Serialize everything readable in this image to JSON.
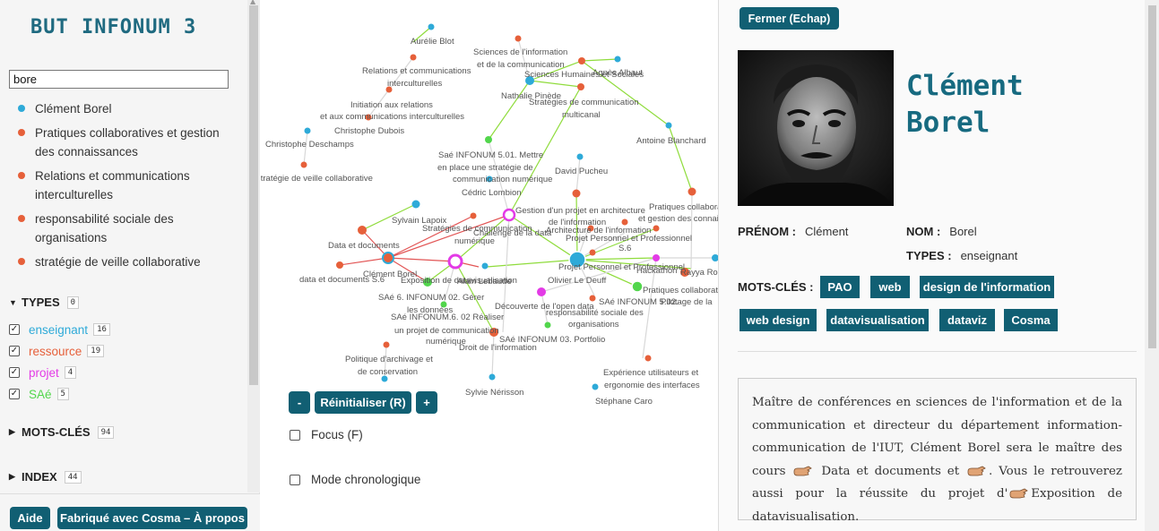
{
  "app": {
    "title": "BUT INFONUM 3"
  },
  "search": {
    "value": "bore"
  },
  "search_results": [
    {
      "label": "Clément Borel",
      "color": "#2eaad8"
    },
    {
      "label": "Pratiques collaboratives et gestion des connaissances",
      "color": "#e6603a"
    },
    {
      "label": "Relations et communications interculturelles",
      "color": "#e6603a"
    },
    {
      "label": "responsabilité sociale des organisations",
      "color": "#e6603a"
    },
    {
      "label": "stratégie de veille collaborative",
      "color": "#e6603a"
    }
  ],
  "types": {
    "label": "TYPES",
    "count": "0",
    "items": [
      {
        "label": "enseignant",
        "count": "16",
        "color": "#2eaad8",
        "checked": true
      },
      {
        "label": "ressource",
        "count": "19",
        "color": "#e6603a",
        "checked": true
      },
      {
        "label": "projet",
        "count": "4",
        "color": "#e33be6",
        "checked": true
      },
      {
        "label": "SAé",
        "count": "5",
        "color": "#52d64c",
        "checked": true
      }
    ]
  },
  "keywords_section": {
    "label": "MOTS-CLÉS",
    "count": "94"
  },
  "index_section": {
    "label": "INDEX",
    "count": "44"
  },
  "footer": {
    "help": "Aide",
    "about": "Fabriqué avec Cosma – À propos"
  },
  "graph": {
    "zoom_out": "-",
    "reset": "Réinitialiser (R)",
    "zoom_in": "+",
    "focus_label": "Focus (F)",
    "chrono_label": "Mode chronologique",
    "labels": [
      "Aurélie Blot",
      "Sciences de l'information",
      "et de la communication",
      "Relations et communications",
      "interculturelles",
      "Sciences Humaines et Sociales",
      "Agnès Albaut",
      "Nathalie Pinède",
      "Stratégies de communication",
      "multicanal",
      "Initiation aux relations",
      "et aux communications interculturelles",
      "Christophe Dubois",
      "Christophe Deschamps",
      "Antoine Blanchard",
      "Saé INFONUM 5.01. Mettre",
      "en place une stratégie de",
      "communication numérique",
      "stratégie de veille collaborative",
      "David Pucheu",
      "Cédric Lombion",
      "Gestion d'un projet en architecture",
      "de l'information",
      "Sylvain Lapoix",
      "Stratégies de communication",
      "numérique",
      "Challenge de la data",
      "Architecture de l'information",
      "Projet Personnel et Professionnel",
      "S.6",
      "Pratiques collabora",
      "et gestion des connais",
      "Data et documents",
      "Clément Borel",
      "data et documents S.6",
      "Exposition de datavisualisation",
      "Alain Lebaude",
      "Projet Personnel et Professionnel",
      "Hackathon",
      "Rayya Ro",
      "Olivier Le Deuff",
      "Pratiques collaborativ",
      "SAé INFONUM 5.02.",
      "Pilotage de la",
      "SAé 6. INFONUM 02. Gérer",
      "les données",
      "Découverte de l'open data",
      "responsabilité sociale des",
      "organisations",
      "SAé INFONUM.6. 02 Réaliser",
      "un projet de communication",
      "numérique",
      "SAé INFONUM 03. Portfolio",
      "Droit de l'information",
      "Politique d'archivage et",
      "de conservation",
      "Expérience utilisateurs et",
      "ergonomie des interfaces",
      "Sylvie Nérisson",
      "Stéphane Caro"
    ]
  },
  "record": {
    "close": "Fermer (Echap)",
    "title_line1": "Clément",
    "title_line2": "Borel",
    "firstname_key": "PRÉNOM :",
    "firstname_value": "Clément",
    "lastname_key": "NOM :",
    "lastname_value": "Borel",
    "types_key": "TYPES :",
    "types_value": "enseignant",
    "keywords_key": "MOTS-CLÉS :",
    "keywords": [
      "PAO",
      "web",
      "design de l'information",
      "web design",
      "datavisualisation",
      "dataviz",
      "Cosma"
    ],
    "description": {
      "part1": "Maître de conférences en sciences de l'information et de la communication et directeur du département information-communication de l'IUT, Clément Borel sera le maître des cours",
      "link1": "Data et documents",
      "part2": "et",
      "part3": ". Vous le retrouverez aussi pour la réussite du projet d'",
      "link2": "Exposition de datavisualisation",
      "part4": "."
    }
  }
}
